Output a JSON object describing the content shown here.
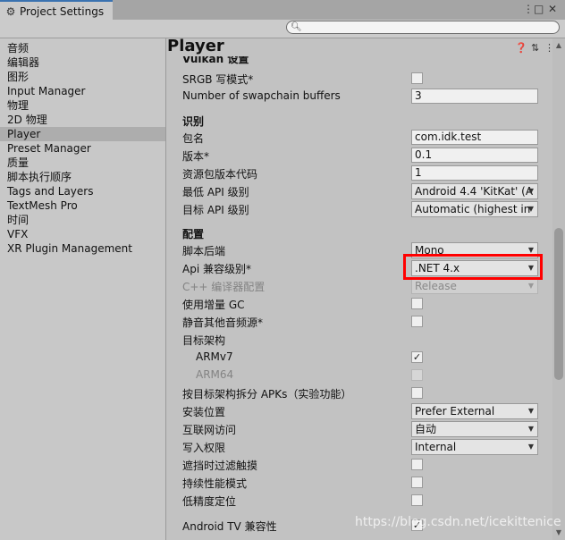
{
  "window": {
    "tab_title": "Project Settings",
    "tab_icon": "gear-icon"
  },
  "sidebar": {
    "items": [
      {
        "label": "音频"
      },
      {
        "label": "编辑器"
      },
      {
        "label": "图形"
      },
      {
        "label": "Input Manager"
      },
      {
        "label": "物理"
      },
      {
        "label": "2D 物理"
      },
      {
        "label": "Player",
        "selected": true
      },
      {
        "label": "Preset Manager"
      },
      {
        "label": "质量"
      },
      {
        "label": "脚本执行顺序"
      },
      {
        "label": "Tags and Layers"
      },
      {
        "label": "TextMesh Pro"
      },
      {
        "label": "时间"
      },
      {
        "label": "VFX"
      },
      {
        "label": "XR Plugin Management"
      }
    ]
  },
  "main": {
    "title": "Player",
    "vulkan": {
      "header": "Vulkan 设置",
      "srgb_label": "SRGB 写模式*",
      "swapchain_label": "Number of swapchain buffers",
      "swapchain_value": "3"
    },
    "identification": {
      "header": "识别",
      "package_label": "包名",
      "package_value": "com.idk.test",
      "version_label": "版本*",
      "version_value": "0.1",
      "bundle_code_label": "资源包版本代码",
      "bundle_code_value": "1",
      "min_api_label": "最低 API 级别",
      "min_api_value": "Android 4.4 'KitKat' (A",
      "target_api_label": "目标 API 级别",
      "target_api_value": "Automatic (highest in"
    },
    "config": {
      "header": "配置",
      "backend_label": "脚本后端",
      "backend_value": "Mono",
      "api_compat_label": "Api 兼容级别*",
      "api_compat_value": ".NET 4.x",
      "cpp_label": "C++ 编译器配置",
      "cpp_value": "Release",
      "incremental_gc_label": "使用增量 GC",
      "mute_audio_label": "静音其他音频源*",
      "arch_label": "目标架构",
      "armv7_label": "ARMv7",
      "arm64_label": "ARM64",
      "split_apk_label": "按目标架构拆分 APKs（实验功能）",
      "install_loc_label": "安装位置",
      "install_loc_value": "Prefer External",
      "internet_label": "互联网访问",
      "internet_value": "自动",
      "write_perm_label": "写入权限",
      "write_perm_value": "Internal",
      "filter_touches_label": "遮挡时过滤触摸",
      "sustained_perf_label": "持续性能模式",
      "low_accuracy_label": "低精度定位",
      "android_tv_label": "Android TV 兼容性"
    }
  },
  "watermark": "https://blog.csdn.net/icekittenice",
  "colors": {
    "highlight": "#ff0000",
    "tab_accent": "#3a72b0"
  }
}
